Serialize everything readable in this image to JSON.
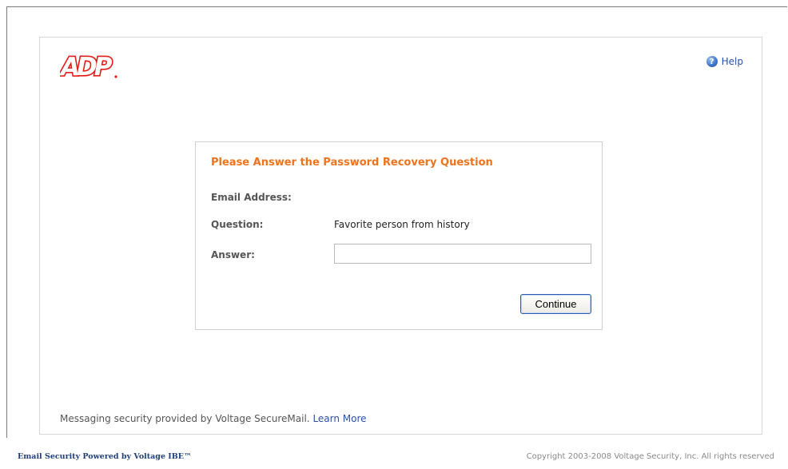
{
  "brand": {
    "logo_text": "ADP",
    "logo_color": "#e41b17"
  },
  "header": {
    "help_label": "Help",
    "help_icon": "question-icon"
  },
  "form": {
    "title": "Please Answer the Password Recovery Question",
    "email_label": "Email Address:",
    "email_value": "",
    "question_label": "Question:",
    "question_value": "Favorite person from history",
    "answer_label": "Answer:",
    "answer_value": "",
    "continue_label": "Continue",
    "title_color": "#f0731c"
  },
  "messaging": {
    "text": "Messaging security provided by Voltage SecureMail.",
    "link": "Learn More"
  },
  "footer": {
    "left": "Email Security Powered by Voltage IBE™",
    "right": "Copyright 2003-2008 Voltage Security, Inc. All rights reserved"
  }
}
